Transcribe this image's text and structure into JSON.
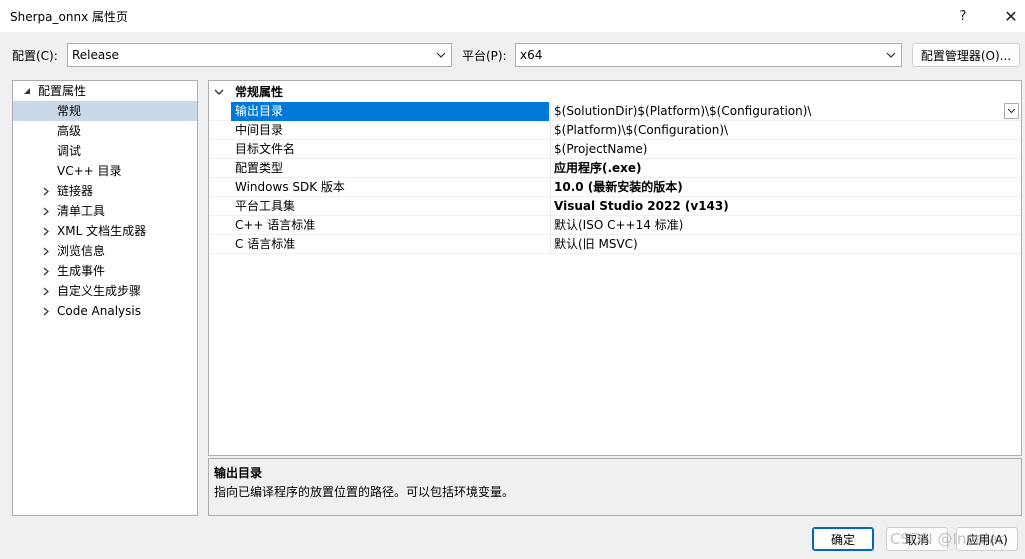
{
  "window": {
    "title": "Sherpa_onnx 属性页",
    "help_glyph": "?",
    "close_glyph": "✕"
  },
  "config_bar": {
    "config_label": "配置(C):",
    "config_value": "Release",
    "platform_label": "平台(P):",
    "platform_value": "x64",
    "manager_button": "配置管理器(O)..."
  },
  "tree": {
    "root": "配置属性",
    "items": [
      {
        "label": "常规",
        "expandable": false,
        "selected": true
      },
      {
        "label": "高级",
        "expandable": false,
        "selected": false
      },
      {
        "label": "调试",
        "expandable": false,
        "selected": false
      },
      {
        "label": "VC++ 目录",
        "expandable": false,
        "selected": false
      },
      {
        "label": "链接器",
        "expandable": true,
        "selected": false
      },
      {
        "label": "清单工具",
        "expandable": true,
        "selected": false
      },
      {
        "label": "XML 文档生成器",
        "expandable": true,
        "selected": false
      },
      {
        "label": "浏览信息",
        "expandable": true,
        "selected": false
      },
      {
        "label": "生成事件",
        "expandable": true,
        "selected": false
      },
      {
        "label": "自定义生成步骤",
        "expandable": true,
        "selected": false
      },
      {
        "label": "Code Analysis",
        "expandable": true,
        "selected": false
      }
    ]
  },
  "grid": {
    "category": "常规属性",
    "properties": [
      {
        "name": "输出目录",
        "value": "$(SolutionDir)$(Platform)\\$(Configuration)\\",
        "bold": false,
        "selected": true
      },
      {
        "name": "中间目录",
        "value": "$(Platform)\\$(Configuration)\\",
        "bold": false,
        "selected": false
      },
      {
        "name": "目标文件名",
        "value": "$(ProjectName)",
        "bold": false,
        "selected": false
      },
      {
        "name": "配置类型",
        "value": "应用程序(.exe)",
        "bold": true,
        "selected": false
      },
      {
        "name": "Windows SDK 版本",
        "value": "10.0 (最新安装的版本)",
        "bold": true,
        "selected": false
      },
      {
        "name": "平台工具集",
        "value": "Visual Studio 2022 (v143)",
        "bold": true,
        "selected": false
      },
      {
        "name": "C++ 语言标准",
        "value": "默认(ISO C++14 标准)",
        "bold": false,
        "selected": false
      },
      {
        "name": "C 语言标准",
        "value": "默认(旧 MSVC)",
        "bold": false,
        "selected": false
      }
    ]
  },
  "description": {
    "title": "输出目录",
    "text": "指向已编译程序的放置位置的路径。可以包括环境变量。"
  },
  "buttons": {
    "ok": "确定",
    "cancel": "取消",
    "apply": "应用(A)"
  },
  "watermark": "CSDN @Invalar",
  "colors": {
    "accent": "#0078d7",
    "selected_tree": "#c9d7e8"
  }
}
